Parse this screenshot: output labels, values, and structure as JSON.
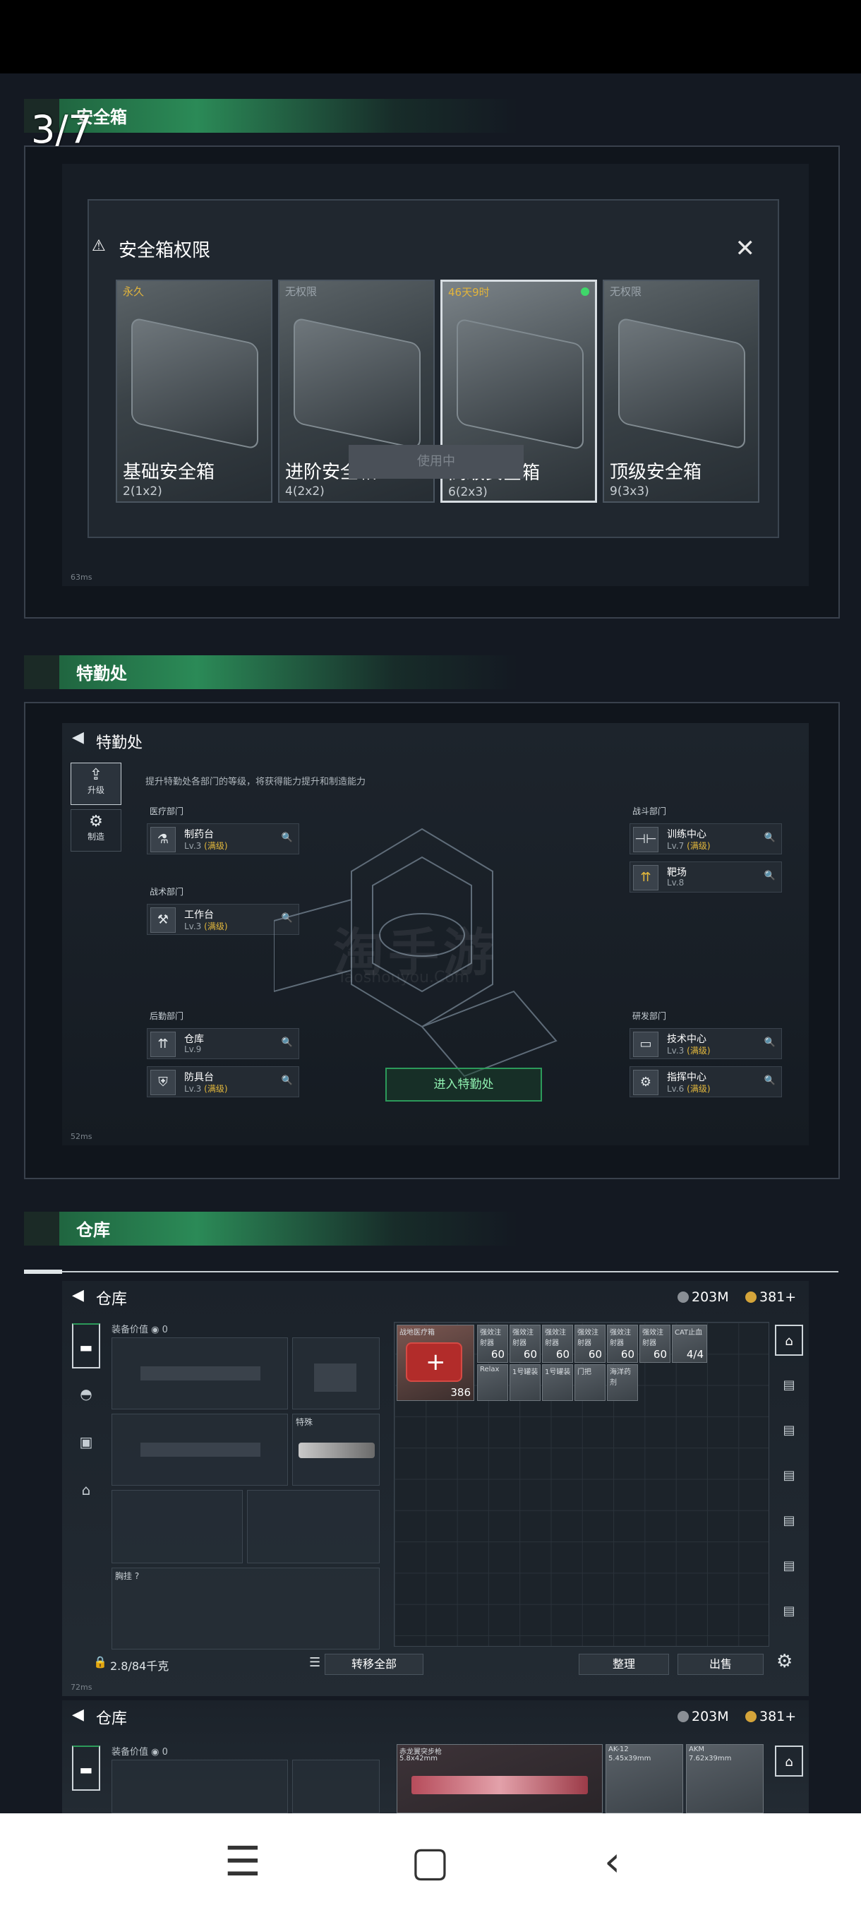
{
  "viewer": {
    "counter": "3/7"
  },
  "sections": {
    "safebox": {
      "header": "安全箱"
    },
    "special_ops": {
      "header": "特勤处"
    },
    "warehouse": {
      "header": "仓库"
    }
  },
  "safebox_dialog": {
    "title": "安全箱权限",
    "cards": [
      {
        "duration": "永久",
        "name": "基础安全箱",
        "size": "2(1x2)"
      },
      {
        "duration": "无权限",
        "name": "进阶安全箱",
        "size": "4(2x2)"
      },
      {
        "duration": "46天9时",
        "name": "高级安全箱",
        "size": "6(2x3)"
      },
      {
        "duration": "无权限",
        "name": "顶级安全箱",
        "size": "9(3x3)"
      }
    ],
    "in_use_button": "使用中",
    "ping": "63ms"
  },
  "special_ops_screen": {
    "title": "特勤处",
    "description": "提升特勤处各部门的等级，将获得能力提升和制造能力",
    "side_tabs": [
      "升级",
      "制造"
    ],
    "departments": {
      "medical": "医疗部门",
      "tactical": "战术部门",
      "logistics": "后勤部门",
      "combat": "战斗部门",
      "research": "研发部门"
    },
    "facilities": {
      "pharmacy": {
        "name": "制药台",
        "level": "Lv.3",
        "max": "(满级)"
      },
      "workbench": {
        "name": "工作台",
        "level": "Lv.3",
        "max": "(满级)"
      },
      "storage": {
        "name": "仓库",
        "level": "Lv.9",
        "max": ""
      },
      "armor": {
        "name": "防具台",
        "level": "Lv.3",
        "max": "(满级)"
      },
      "training": {
        "name": "训练中心",
        "level": "Lv.7",
        "max": "(满级)"
      },
      "range": {
        "name": "靶场",
        "level": "Lv.8",
        "max": ""
      },
      "tech": {
        "name": "技术中心",
        "level": "Lv.3",
        "max": "(满级)"
      },
      "command": {
        "name": "指挥中心",
        "level": "Lv.6",
        "max": "(满级)"
      }
    },
    "enter_button": "进入特勤处",
    "watermark": "淘手游",
    "watermark_sub": "Taoshouyou.Com",
    "ping": "52ms"
  },
  "warehouse_screen": {
    "title": "仓库",
    "currency1": "203M",
    "currency2": "381+",
    "equip_value_label": "装备价值",
    "equip_value": "0",
    "special_slot_label": "特殊",
    "chest_rig_label": "胸挂 ?",
    "capacity": "2.8/84千克",
    "transfer_all": "转移全部",
    "sort_button": "整理",
    "sell_button": "出售",
    "items_row1": [
      {
        "name": "战地医疗箱",
        "qty": "386"
      },
      {
        "name": "强效注射器",
        "qty": "60"
      },
      {
        "name": "强效注射器",
        "qty": "60"
      },
      {
        "name": "强效注射器",
        "qty": "60"
      },
      {
        "name": "强效注射器",
        "qty": "60"
      },
      {
        "name": "强效注射器",
        "qty": "60"
      },
      {
        "name": "强效注射器",
        "qty": "60"
      },
      {
        "name": "CAT止血",
        "qty": "4/4"
      }
    ],
    "items_row2": [
      "Relax",
      "1号罐装",
      "1号罐装",
      "门把",
      "海洋药剂"
    ],
    "ping": "72ms"
  },
  "warehouse_screen_2": {
    "title": "仓库",
    "currency1": "203M",
    "currency2": "381+",
    "equip_value_label": "装备价值",
    "equip_value": "0",
    "weapons": [
      {
        "name": "赤龙翼突步枪",
        "caliber": "5.8x42mm"
      },
      {
        "name": "AK-12",
        "caliber": "5.45x39mm"
      },
      {
        "name": "AKM",
        "caliber": "7.62x39mm"
      }
    ]
  },
  "nav": {
    "menu": "☰",
    "home": "▢",
    "back": "‹"
  }
}
